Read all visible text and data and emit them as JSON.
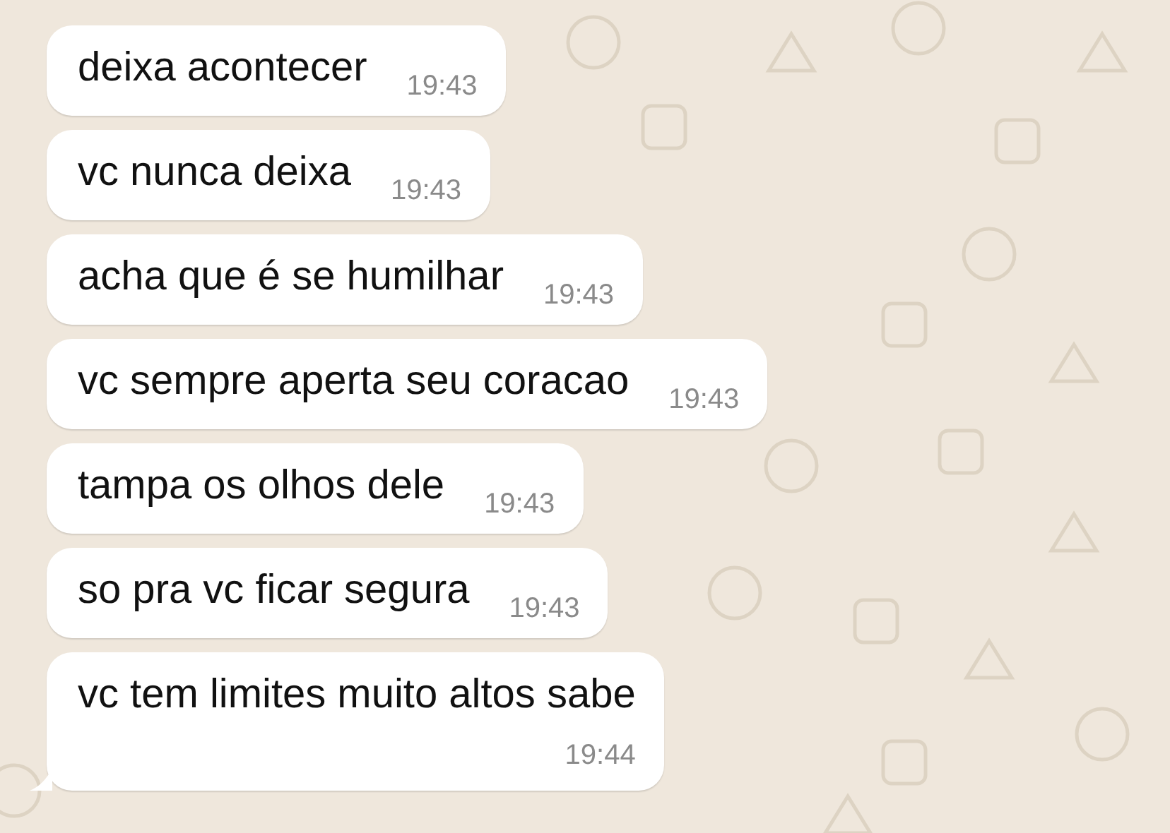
{
  "messages": [
    {
      "text": "deixa acontecer",
      "time": "19:43",
      "kind": "inline",
      "tail": false
    },
    {
      "text": "vc nunca deixa",
      "time": "19:43",
      "kind": "inline",
      "tail": false
    },
    {
      "text": "acha que é se humilhar",
      "time": "19:43",
      "kind": "inline",
      "tail": false
    },
    {
      "text": "vc sempre aperta seu coracao",
      "time": "19:43",
      "kind": "inline",
      "tail": false
    },
    {
      "text": "tampa os olhos dele",
      "time": "19:43",
      "kind": "inline",
      "tail": false
    },
    {
      "text": "so pra vc ficar segura",
      "time": "19:43",
      "kind": "inline",
      "tail": false
    },
    {
      "text": "vc tem limites muito altos sabe",
      "time": "19:44",
      "kind": "stacked",
      "tail": true
    }
  ]
}
